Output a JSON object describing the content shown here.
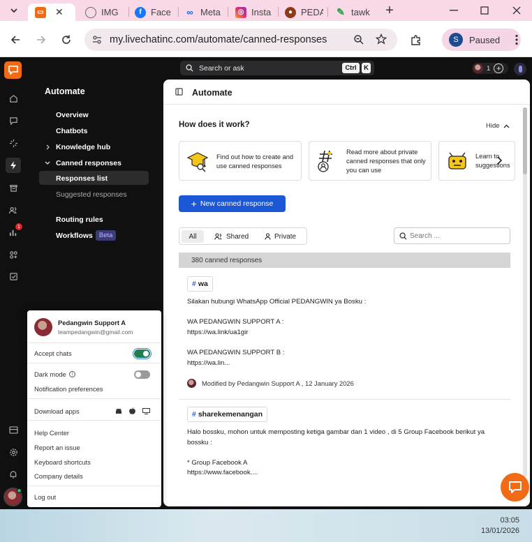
{
  "browser": {
    "tabs": [
      {
        "label": "",
        "active": true
      },
      {
        "label": "IMG"
      },
      {
        "label": "Face"
      },
      {
        "label": "Meta"
      },
      {
        "label": "Insta"
      },
      {
        "label": "PEDA"
      },
      {
        "label": "tawk"
      }
    ],
    "url": "my.livechatinc.com/automate/canned-responses",
    "profile_initial": "S",
    "profile_status": "Paused"
  },
  "topbar": {
    "search_label": "Search or ask",
    "shortcut_ctrl": "Ctrl",
    "shortcut_k": "K",
    "agents_count": "1"
  },
  "sidebar": {
    "badge_count": "1"
  },
  "nav": {
    "title": "Automate",
    "overview": "Overview",
    "chatbots": "Chatbots",
    "knowledge_hub": "Knowledge hub",
    "canned_responses": "Canned responses",
    "responses_list": "Responses list",
    "suggested_responses": "Suggested responses",
    "routing_rules": "Routing rules",
    "workflows": "Workflows",
    "beta": "Beta"
  },
  "main": {
    "title": "Automate",
    "how_title": "How does it work?",
    "hide_label": "Hide",
    "cards": [
      "Find out how to create and use canned responses",
      "Read more about private canned responses that only you can use",
      "Learn to suggestions"
    ],
    "new_button": "New canned response",
    "filters": {
      "all": "All",
      "shared": "Shared",
      "private": "Private"
    },
    "search_placeholder": "Search ...",
    "count_text": "380 canned responses",
    "responses": [
      {
        "tag": "wa",
        "body": "Silakan hubungi WhatsApp Official PEDANGWIN ya Bosku :\n\nWA PEDANGWIN SUPPORT A :\nhttps://wa.link/ua1gir\n\nWA PEDANGWIN SUPPORT B :\nhttps://wa.lin...",
        "modified": "Modified by Pedangwin Support A , 12 January 2026"
      },
      {
        "tag": "sharekemenangan",
        "body": "Halo bossku, mohon untuk memposting ketiga gambar dan 1 video , di 5 Group Facebook berikut ya\nbossku :\n\n* Group Facebook A\nhttps://www.facebook....",
        "modified": ""
      }
    ]
  },
  "popup": {
    "name": "Pedangwin Support A",
    "email": "teampedangwin@gmail.com",
    "accept_chats": "Accept chats",
    "accept_chats_on": true,
    "dark_mode": "Dark mode",
    "dark_mode_on": false,
    "notification_prefs": "Notification preferences",
    "download_apps": "Download apps",
    "help_center": "Help Center",
    "report_issue": "Report an issue",
    "keyboard_shortcuts": "Keyboard shortcuts",
    "company_details": "Company details",
    "log_out": "Log out"
  },
  "taskbar": {
    "time": "03:05",
    "date": "13/01/2026"
  },
  "colors": {
    "brand_orange": "#f16a16",
    "primary_blue": "#1c57d6",
    "toggle_on": "#1e7e52"
  }
}
